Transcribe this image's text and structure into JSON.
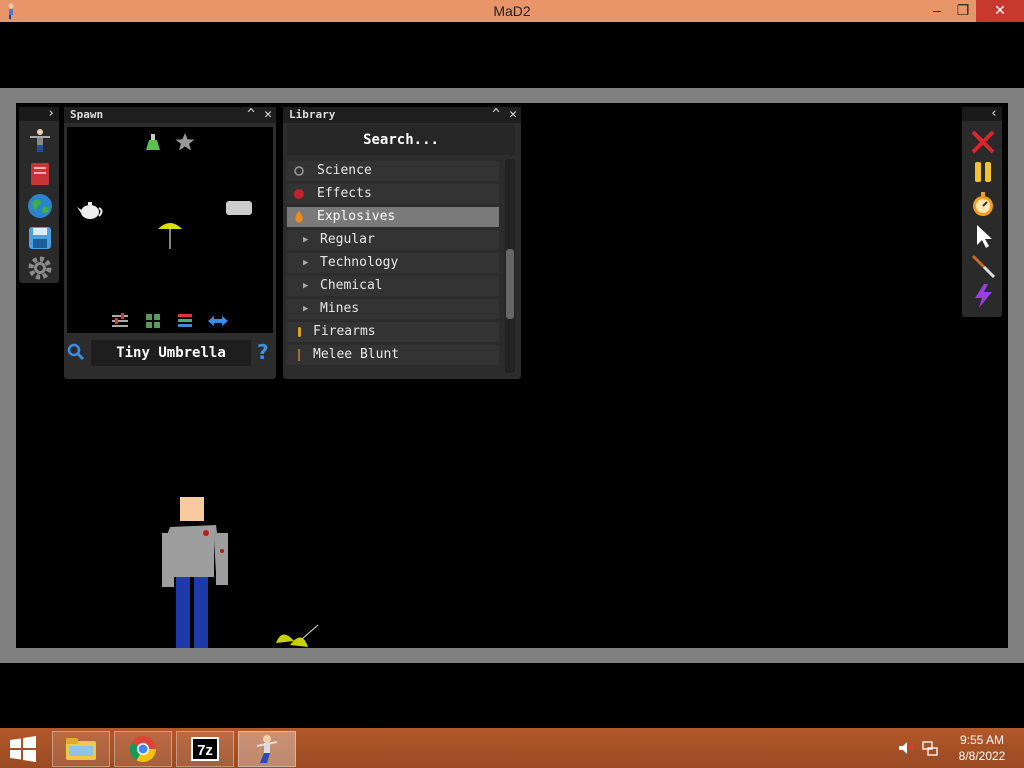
{
  "window": {
    "title": "MaD2",
    "minimize": "–",
    "maximize": "❐",
    "close": "✕"
  },
  "leftbar": {
    "toggle": "›",
    "tools": [
      "ragdoll-icon",
      "book-icon",
      "globe-icon",
      "save-icon",
      "settings-gear-icon"
    ]
  },
  "spawn": {
    "title": "Spawn",
    "collapse": "^",
    "close": "✕",
    "selected_name": "Tiny Umbrella",
    "help": "?"
  },
  "library": {
    "title": "Library",
    "collapse": "^",
    "close": "✕",
    "search_placeholder": "Search...",
    "items": [
      {
        "label": "Science",
        "kind": "category"
      },
      {
        "label": "Effects",
        "kind": "category"
      },
      {
        "label": "Explosives",
        "kind": "category",
        "selected": true
      },
      {
        "label": "Regular",
        "kind": "sub"
      },
      {
        "label": "Technology",
        "kind": "sub"
      },
      {
        "label": "Chemical",
        "kind": "sub"
      },
      {
        "label": "Mines",
        "kind": "sub"
      },
      {
        "label": "Firearms",
        "kind": "category"
      },
      {
        "label": "Melee Blunt",
        "kind": "category"
      }
    ]
  },
  "rightbar": {
    "toggle": "‹",
    "tools": [
      "clear-icon",
      "pause-icon",
      "stopwatch-icon",
      "cursor-icon",
      "knife-icon",
      "lightning-icon"
    ]
  },
  "taskbar": {
    "time": "9:55 AM",
    "date": "8/8/2022"
  },
  "colors": {
    "titlebar": "#e8956a",
    "frame": "#808080",
    "taskbar": "#a85026",
    "selected_row": "#7a7a7a"
  }
}
